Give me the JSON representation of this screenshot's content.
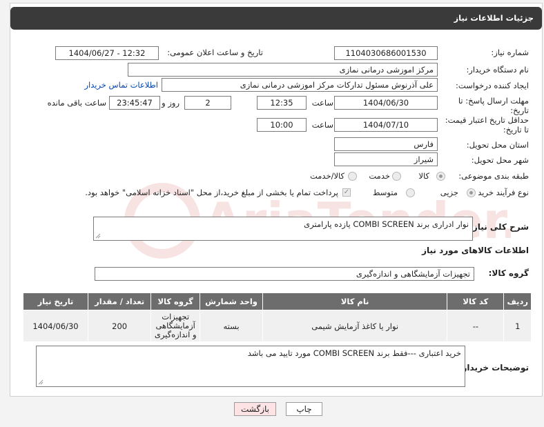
{
  "header": {
    "title": "جزئیات اطلاعات نیاز"
  },
  "form": {
    "need_number": {
      "label": "شماره نیاز:",
      "value": "1104030686001530"
    },
    "announce": {
      "label": "تاریخ و ساعت اعلان عمومی:",
      "value": "1404/06/27 - 12:32"
    },
    "buyer_org": {
      "label": "نام دستگاه خریدار:",
      "value": "مرکز اموزشی درمانی نمازی"
    },
    "requester": {
      "label": "ایجاد کننده درخواست:",
      "value": "علی آذرنوش مسئول تدارکات مرکز اموزشی درمانی نمازی",
      "contact_link": "اطلاعات تماس خریدار"
    },
    "reply_deadline": {
      "label": "مهلت ارسال پاسخ: تا تاریخ:",
      "date": "1404/06/30",
      "time_label": "ساعت",
      "time": "12:35",
      "days": "2",
      "days_label": "روز و",
      "remaining": "23:45:47",
      "remaining_label": "ساعت باقی مانده"
    },
    "price_validity": {
      "label": "حداقل تاریخ اعتبار قیمت: تا تاریخ:",
      "date": "1404/07/10",
      "time_label": "ساعت",
      "time": "10:00"
    },
    "province": {
      "label": "استان محل تحویل:",
      "value": "فارس"
    },
    "city": {
      "label": "شهر محل تحویل:",
      "value": "شیراز"
    },
    "category": {
      "label": "طبقه بندی موضوعی:",
      "options": [
        "کالا",
        "خدمت",
        "کالا/خدمت"
      ],
      "selected": "کالا"
    },
    "purchase_type": {
      "label": "نوع فرآیند خرید :",
      "options": [
        "جزیی",
        "متوسط"
      ],
      "selected": "جزیی",
      "note": "پرداخت تمام یا بخشی از مبلغ خرید،از محل \"اسناد خزانه اسلامی\" خواهد بود."
    }
  },
  "summary": {
    "label": "شرح کلی نیاز:",
    "value": "نوار ادراری برند COMBI SCREEN  یازده پارامتری"
  },
  "goods_section": {
    "title": "اطلاعات کالاهای مورد نیاز"
  },
  "goods_group": {
    "label": "گروه کالا:",
    "value": "تجهیزات آزمایشگاهی و اندازه‌گیری"
  },
  "table": {
    "headers": [
      "ردیف",
      "کد کالا",
      "نام کالا",
      "واحد شمارش",
      "گروه کالا",
      "تعداد / مقدار",
      "تاریخ نیاز"
    ],
    "rows": [
      [
        "1",
        "--",
        "نوار یا کاغذ آزمایش شیمی",
        "بسته",
        "تجهیزات آزمایشگاهی و اندازه‌گیری",
        "200",
        "1404/06/30"
      ]
    ]
  },
  "buyer_notes": {
    "label": "توضیحات خریدار:",
    "value": "خرید اعتباری ---فقط برند COMBI SCREEN مورد تایید می باشد"
  },
  "buttons": {
    "print": "چاپ",
    "back": "بازگشت"
  },
  "watermark": {
    "text": "AriaTender.neT"
  }
}
